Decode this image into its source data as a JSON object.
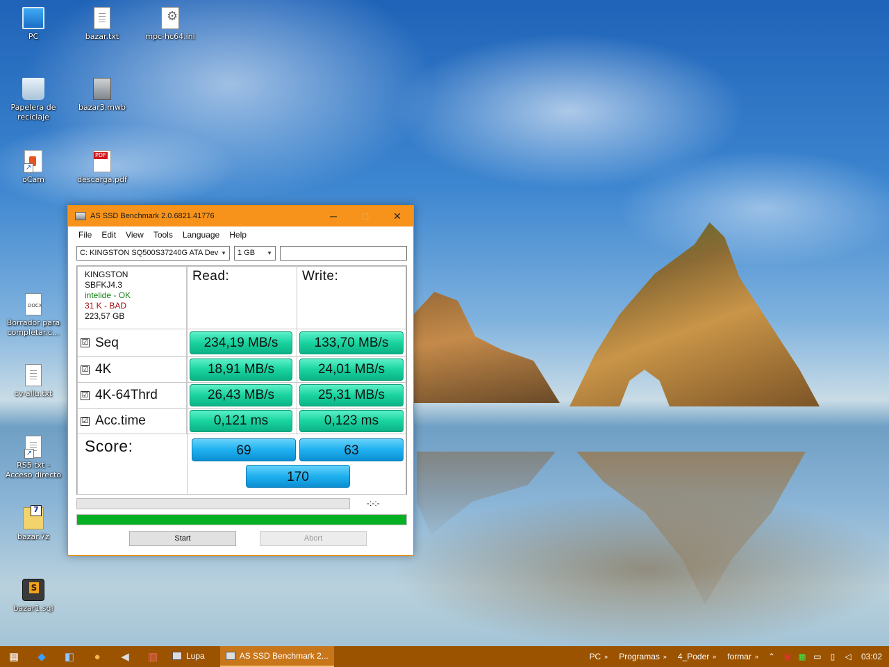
{
  "desktop": {
    "icons": [
      {
        "label": "PC",
        "icon": "computer-icon"
      },
      {
        "label": "bazar.txt",
        "icon": "text-file-icon"
      },
      {
        "label": "mpc-hc64.ini",
        "icon": "settings-file-icon"
      },
      {
        "label": "Papelera de reciclaje",
        "icon": "recycle-bin-icon"
      },
      {
        "label": "bazar3.mwb",
        "icon": "workbench-file-icon"
      },
      {
        "label": "oCam",
        "icon": "ocam-icon"
      },
      {
        "label": "descarga.pdf",
        "icon": "pdf-file-icon"
      },
      {
        "label": "Borrador para completar.c...",
        "icon": "docx-file-icon"
      },
      {
        "label": "cv-allu.txt",
        "icon": "text-file-icon"
      },
      {
        "label": "RS5.txt - Acceso directo",
        "icon": "shortcut-icon"
      },
      {
        "label": "bazar.7z",
        "icon": "archive-icon"
      },
      {
        "label": "bazar1.sql",
        "icon": "sql-file-icon"
      }
    ]
  },
  "window": {
    "title": "AS SSD Benchmark 2.0.6821.41776",
    "controls": {
      "minimize": "─",
      "maximize": "□",
      "close": "✕"
    },
    "menu": [
      "File",
      "Edit",
      "View",
      "Tools",
      "Language",
      "Help"
    ],
    "drive_select": "C: KINGSTON SQ500S37240G ATA Dev",
    "size_select": "1 GB",
    "drive_info": {
      "model": "KINGSTON",
      "firmware": "SBFKJ4.3",
      "driver": "intelide - OK",
      "alignment": "31 K - BAD",
      "capacity": "223,57 GB"
    },
    "headers": {
      "read": "Read:",
      "write": "Write:"
    },
    "tests": [
      {
        "label": "Seq",
        "checked": "☑",
        "read": "234,19 MB/s",
        "write": "133,70 MB/s"
      },
      {
        "label": "4K",
        "checked": "☑",
        "read": "18,91 MB/s",
        "write": "24,01 MB/s"
      },
      {
        "label": "4K-64Thrd",
        "checked": "☑",
        "read": "26,43 MB/s",
        "write": "25,31 MB/s"
      },
      {
        "label": "Acc.time",
        "checked": "☑",
        "read": "0,121 ms",
        "write": "0,123 ms"
      }
    ],
    "score": {
      "label": "Score:",
      "read": "69",
      "write": "63",
      "total": "170"
    },
    "timer": "-:-:-",
    "progress_fraction": 1.0,
    "progress_color": "#06b025",
    "buttons": {
      "start": "Start",
      "abort": "Abort"
    }
  },
  "taskbar": {
    "pinned": [
      "task-view-icon",
      "vscode-icon",
      "app-icon",
      "firefox-icon",
      "speaker-app-icon",
      "winrar-icon"
    ],
    "tasks": [
      {
        "label": "Lupa",
        "active": false
      },
      {
        "label": "AS SSD Benchmark 2...",
        "active": true
      }
    ],
    "toolbars": [
      "PC",
      "Programas",
      "4_Poder",
      "formar"
    ],
    "chevron": "»",
    "clock": "03:02",
    "accent": "#9b5300"
  }
}
